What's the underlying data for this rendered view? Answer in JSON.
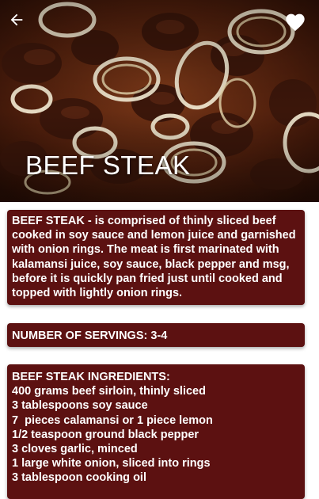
{
  "header": {
    "title": "BEEF STEAK",
    "back_icon": "arrow-left-icon",
    "favorite_icon": "heart-icon"
  },
  "description": {
    "text": "BEEF STEAK - is comprised of thinly sliced beef cooked in soy sauce and lemon juice and garnished with onion rings. The meat is first marinated with kalamansi juice, soy sauce, black pepper and msg, before it is quickly pan fried just until cooked and topped with lightly onion rings."
  },
  "servings": {
    "text": "NUMBER OF SERVINGS: 3-4"
  },
  "ingredients": {
    "heading": "BEEF STEAK INGREDIENTS:",
    "items": [
      "400 grams beef sirloin, thinly sliced",
      "3 tablespoons soy sauce",
      "7  pieces calamansi or 1 piece lemon",
      "1/2 teaspoon ground black pepper",
      "3 cloves garlic, minced",
      "1 large white onion, sliced into rings",
      "3 tablespoon cooking oil"
    ]
  },
  "colors": {
    "card_background": "#5c1111",
    "card_text": "#ffffff",
    "page_background": "#ffffff"
  }
}
